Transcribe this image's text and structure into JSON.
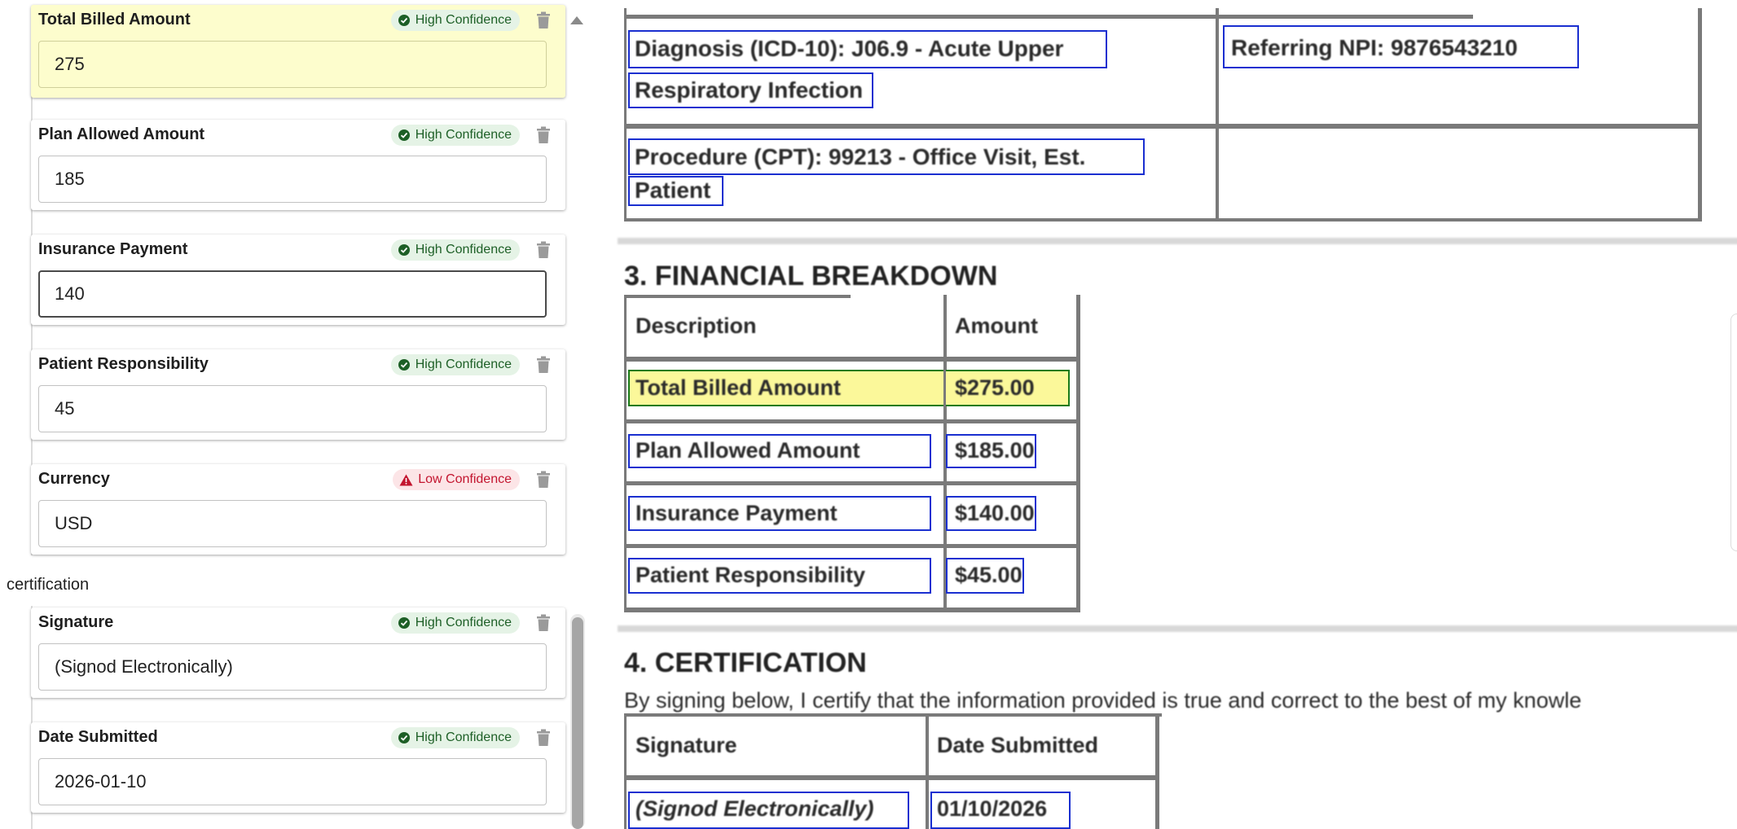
{
  "fields": [
    {
      "label": "Total Billed Amount",
      "value": "275",
      "confidence": "High Confidence",
      "level": "high"
    },
    {
      "label": "Plan Allowed Amount",
      "value": "185",
      "confidence": "High Confidence",
      "level": "high"
    },
    {
      "label": "Insurance Payment",
      "value": "140",
      "confidence": "High Confidence",
      "level": "high"
    },
    {
      "label": "Patient Responsibility",
      "value": "45",
      "confidence": "High Confidence",
      "level": "high"
    },
    {
      "label": "Currency",
      "value": "USD",
      "confidence": "Low Confidence",
      "level": "low"
    }
  ],
  "certification": {
    "section_label": "certification",
    "fields": [
      {
        "label": "Signature",
        "value": "(Signod Electronically)",
        "confidence": "High Confidence",
        "level": "high"
      },
      {
        "label": "Date Submitted",
        "value": "2026-01-10",
        "confidence": "High Confidence",
        "level": "high"
      }
    ]
  },
  "document": {
    "diagnosis_line1": "Diagnosis (ICD-10): J06.9 - Acute Upper",
    "diagnosis_line2": "Respiratory Infection",
    "referring_npi": "Referring NPI: 9876543210",
    "procedure_line1": "Procedure (CPT): 99213 - Office Visit, Est.",
    "procedure_line2": "Patient",
    "financial_heading": "3. FINANCIAL BREAKDOWN",
    "col_description": "Description",
    "col_amount": "Amount",
    "rows": [
      {
        "description": "Total Billed Amount",
        "amount": "$275.00"
      },
      {
        "description": "Plan Allowed Amount",
        "amount": "$185.00"
      },
      {
        "description": "Insurance Payment",
        "amount": "$140.00"
      },
      {
        "description": "Patient Responsibility",
        "amount": "$45.00"
      }
    ],
    "certification_heading": "4. CERTIFICATION",
    "certification_text": "By signing below, I certify that the information provided is true and correct to the best of my knowle",
    "col_signature": "Signature",
    "col_date": "Date Submitted",
    "signature_value": "(Signod Electronically)",
    "date_value": "01/10/2026"
  },
  "colors": {
    "high": "#1d5f26",
    "low": "#c3152f",
    "highlight": "#fdfdcd",
    "box": "#1a2fd0"
  }
}
